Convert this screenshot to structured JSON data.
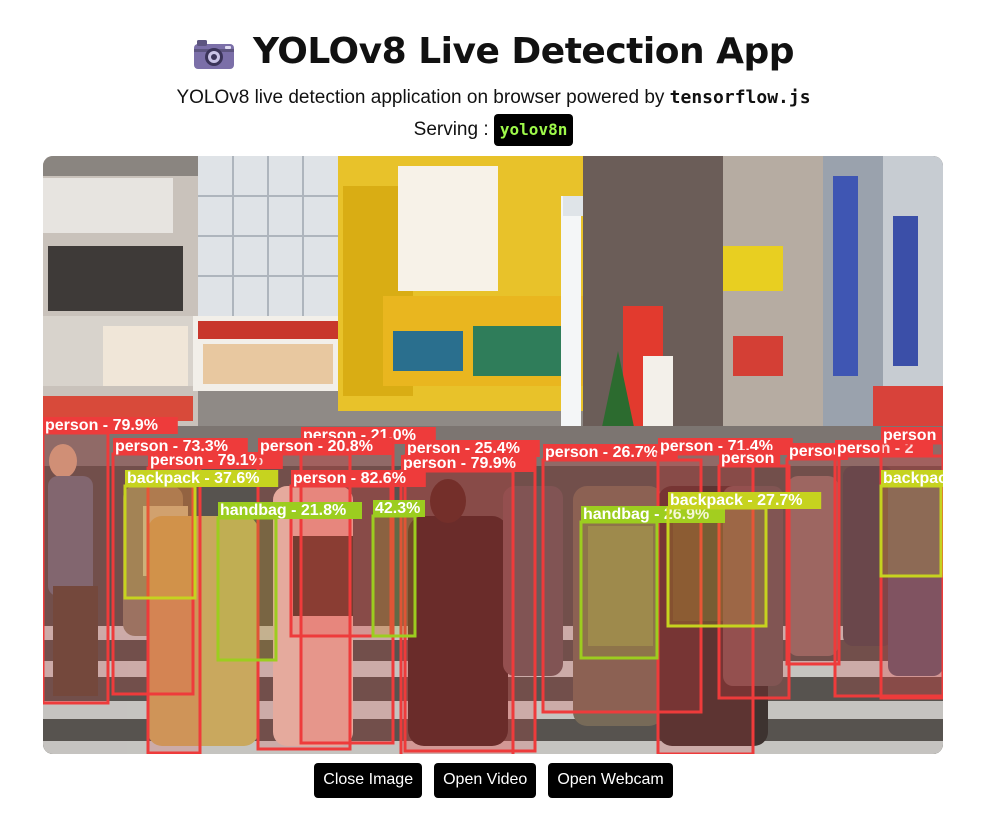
{
  "header": {
    "title": "YOLOv8 Live Detection App",
    "icon": "camera-icon",
    "subtitle_prefix": "YOLOv8 live detection application on browser powered by ",
    "subtitle_code": "tensorflow.js",
    "serving_label": "Serving : ",
    "model_name": "yolov8n"
  },
  "colors": {
    "person": "#ee3b3b",
    "backpack": "#c6d31f",
    "handbag": "#9ccd1f",
    "badge_text": "#9ef94a"
  },
  "detections": [
    {
      "label": "person - 79.9%"
    },
    {
      "label": "person - 73.3%"
    },
    {
      "label": "person - 79.1%"
    },
    {
      "label": "person - 21.0%"
    },
    {
      "label": "person - 20.8%"
    },
    {
      "label": "person - 25.4%"
    },
    {
      "label": "person - 79.9%"
    },
    {
      "label": "person - 26.7%"
    },
    {
      "label": "person - 71.4%"
    },
    {
      "label": "person"
    },
    {
      "label": "person"
    },
    {
      "label": "person - 2"
    },
    {
      "label": "person"
    },
    {
      "label": "person - 82.6%"
    },
    {
      "label": "backpack - 37.6%"
    },
    {
      "label": "handbag - 21.8%"
    },
    {
      "label": "42.3%"
    },
    {
      "label": "handbag - 26.9%"
    },
    {
      "label": "backpack - 27.7%"
    },
    {
      "label": "backpack"
    }
  ],
  "controls": {
    "close_image": "Close Image",
    "open_video": "Open Video",
    "open_webcam": "Open Webcam"
  }
}
